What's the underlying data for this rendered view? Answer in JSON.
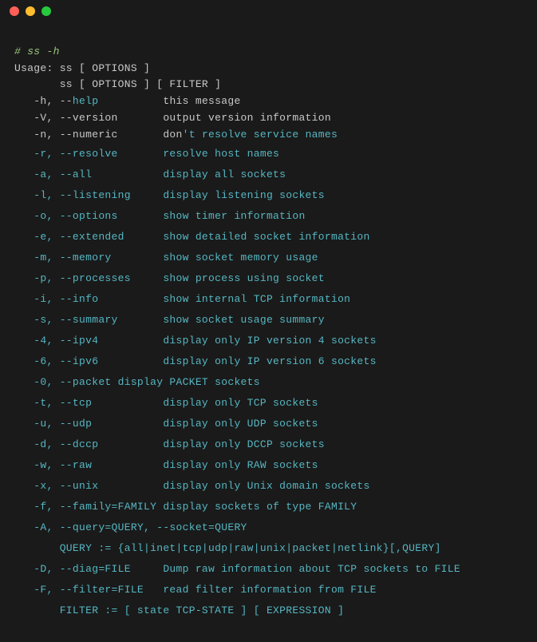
{
  "prompt": "# ss -h",
  "usage1": "Usage: ss [ OPTIONS ]",
  "usage2": "       ss [ OPTIONS ] [ FILTER ]",
  "options": {
    "help_pre": "   -h, --",
    "help_word": "help",
    "help_desc": "          this message",
    "version": "   -V, --version       output version information",
    "numeric_pre": "   -n, --numeric       don",
    "numeric_post": "'t resolve service names",
    "resolve": "   -r, --resolve       resolve host names",
    "all": "   -a, --all           display all sockets",
    "listening": "   -l, --listening     display listening sockets",
    "options_flag": "   -o, --options       show timer information",
    "extended": "   -e, --extended      show detailed socket information",
    "memory": "   -m, --memory        show socket memory usage",
    "processes": "   -p, --processes     show process using socket",
    "info": "   -i, --info          show internal TCP information",
    "summary": "   -s, --summary       show socket usage summary",
    "ipv4": "   -4, --ipv4          display only IP version 4 sockets",
    "ipv6": "   -6, --ipv6          display only IP version 6 sockets",
    "packet": "   -0, --packet display PACKET sockets",
    "tcp": "   -t, --tcp           display only TCP sockets",
    "udp": "   -u, --udp           display only UDP sockets",
    "dccp": "   -d, --dccp          display only DCCP sockets",
    "raw": "   -w, --raw           display only RAW sockets",
    "unix": "   -x, --unix          display only Unix domain sockets",
    "family": "   -f, --family=FAMILY display sockets of type FAMILY",
    "query": "   -A, --query=QUERY, --socket=QUERY",
    "query_def": "       QUERY := {all|inet|tcp|udp|raw|unix|packet|netlink}[,QUERY]",
    "diag": "   -D, --diag=FILE     Dump raw information about TCP sockets to FILE",
    "filter": "   -F, --filter=FILE   read filter information from FILE",
    "filter_def": "       FILTER := [ state TCP-STATE ] [ EXPRESSION ]"
  }
}
